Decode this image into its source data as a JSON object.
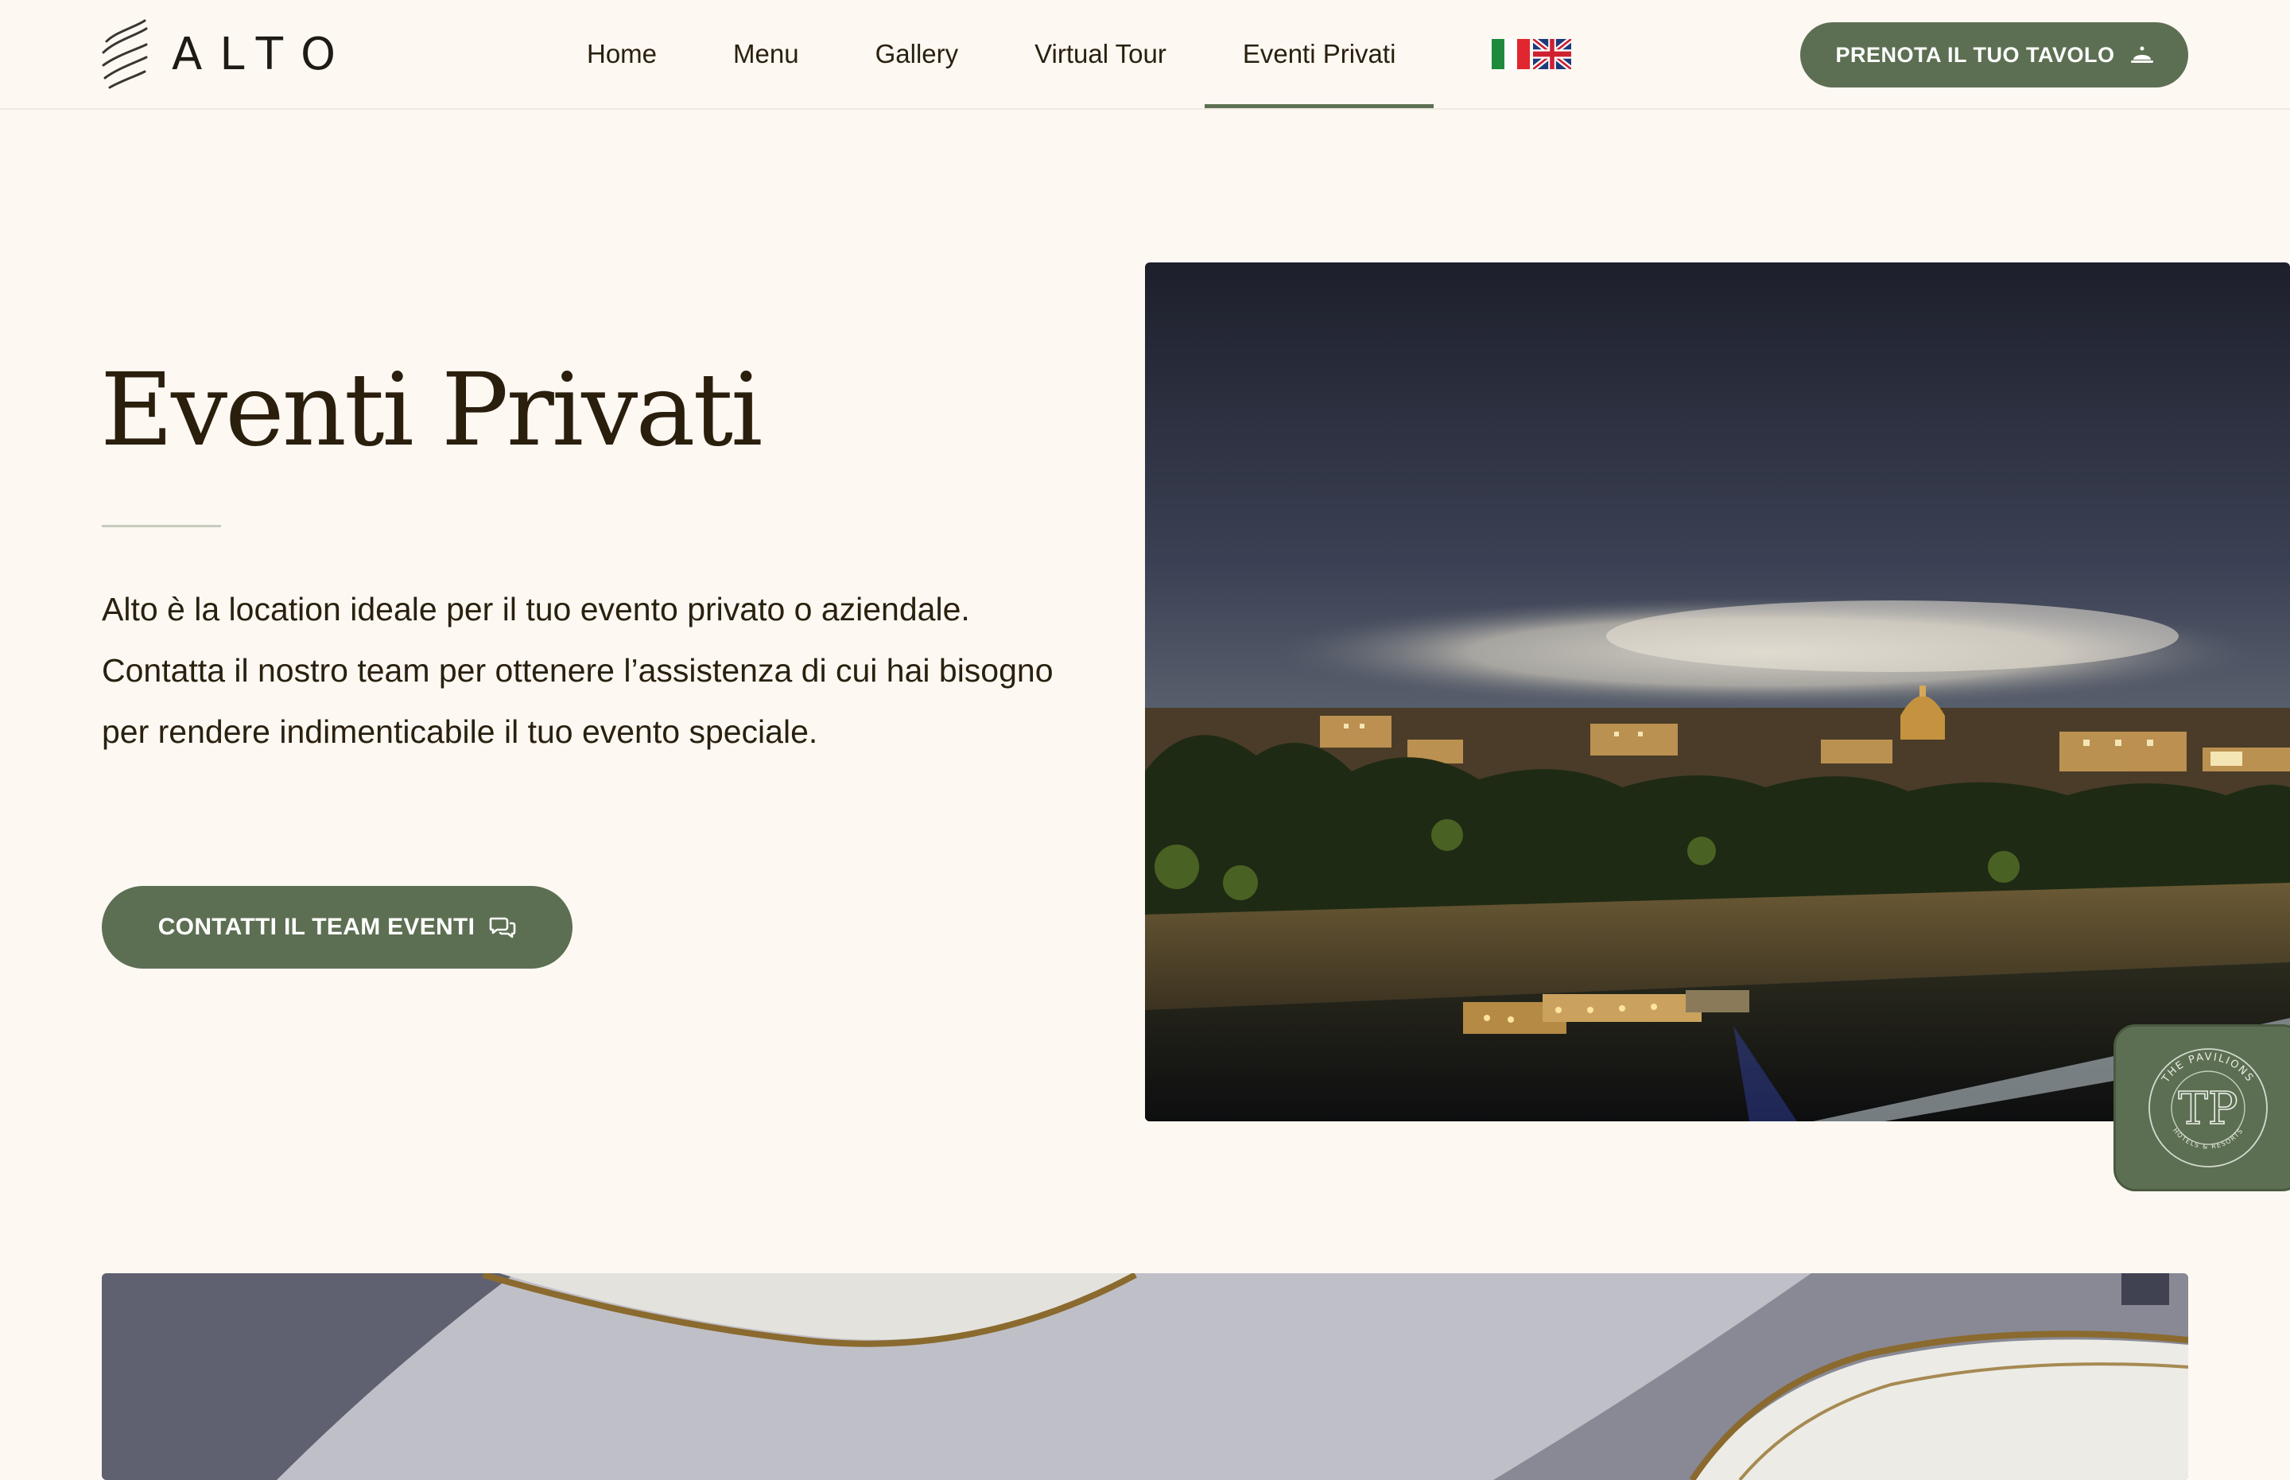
{
  "brand": {
    "name": "ALTO",
    "badge_text_top": "THE PAVILIONS",
    "badge_text_bottom": "HOTELS & RESORTS",
    "badge_monogram": "TP"
  },
  "nav": {
    "items": [
      {
        "label": "Home",
        "active": false
      },
      {
        "label": "Menu",
        "active": false
      },
      {
        "label": "Gallery",
        "active": false
      },
      {
        "label": "Virtual Tour",
        "active": false
      },
      {
        "label": "Eventi Privati",
        "active": true
      }
    ],
    "languages": [
      "it-flag-icon",
      "uk-flag-icon"
    ],
    "reserve_label": "PRENOTA IL TUO TAVOLO",
    "reserve_icon": "cloche-icon"
  },
  "hero": {
    "title": "Eventi Privati",
    "text": "Alto è la location ideale per il tuo evento privato o aziendale. Contatta il nostro team per ottenere l’assistenza di cui hai bisogno per rendere indimenticabile il tuo evento speciale.",
    "cta_label": "CONTATTI IL TEAM EVENTI",
    "cta_icon": "chat-icon"
  },
  "colors": {
    "accent": "#5d6f53",
    "background": "#fdf8f2",
    "text": "#2a200f"
  }
}
